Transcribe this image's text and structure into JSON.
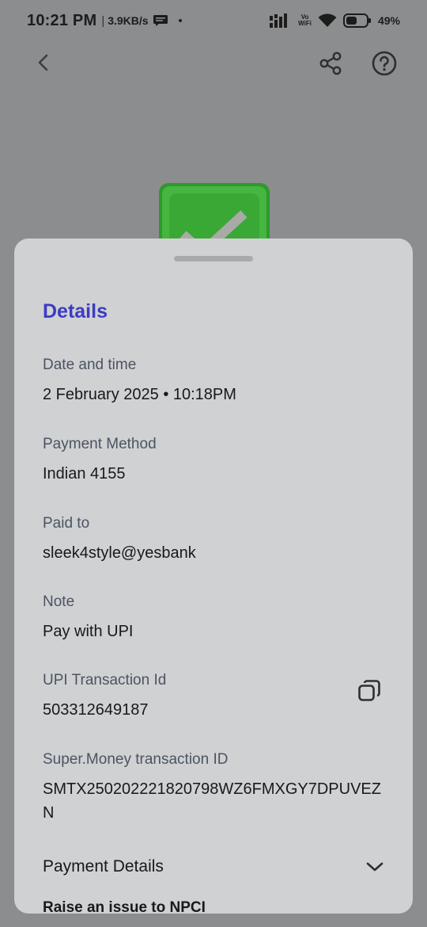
{
  "status_bar": {
    "time": "10:21 PM",
    "separator": "|",
    "net_speed": "3.9KB/s",
    "vo_wifi": "Vo\nWiFi",
    "battery": "49%",
    "icons": [
      "message-icon",
      "signal-icon",
      "vo-wifi-icon",
      "wifi-icon",
      "battery-icon"
    ]
  },
  "top_bar": {
    "icons": [
      "back-icon",
      "share-icon",
      "help-icon"
    ]
  },
  "badge": {
    "icon": "check-icon",
    "color": "#3fb33a"
  },
  "sheet": {
    "title": "Details",
    "fields": [
      {
        "label": "Date and time",
        "value": "2 February 2025 • 10:18PM"
      },
      {
        "label": "Payment Method",
        "value": "Indian 4155"
      },
      {
        "label": "Paid to",
        "value": "sleek4style@yesbank"
      },
      {
        "label": "Note",
        "value": "Pay with UPI"
      },
      {
        "label": "UPI Transaction Id",
        "value": "503312649187"
      },
      {
        "label": "Super.Money transaction ID",
        "value": "SMTX250202221820798WZ6FMXGY7DPUVEZN"
      }
    ],
    "payment_details": "Payment Details",
    "raise_issue": "Raise an issue to NPCI"
  },
  "colors": {
    "accent": "#3d3bc4",
    "scrim": "#8c8d8e",
    "sheet": "#d0d1d3"
  }
}
